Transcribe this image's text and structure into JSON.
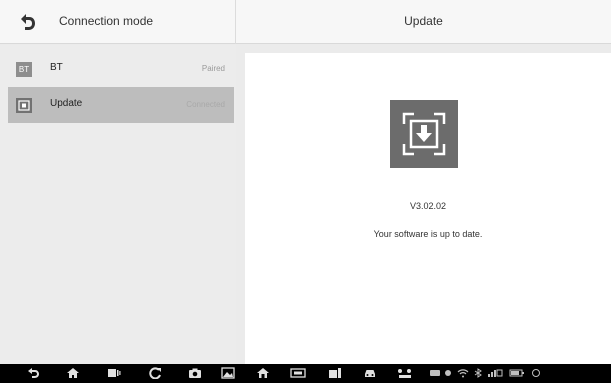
{
  "header": {
    "left_title": "Connection mode",
    "right_title": "Update"
  },
  "sidebar": {
    "items": [
      {
        "icon": "bt-icon",
        "icon_text": "BT",
        "label": "BT",
        "status": "Paired",
        "active": false
      },
      {
        "icon": "vci-box-icon",
        "label": "Update",
        "status": "Connected",
        "active": true
      }
    ]
  },
  "main": {
    "icon": "download-update-icon",
    "version": "V3.02.02",
    "message": "Your software is up to date."
  },
  "nav_bar": {
    "icons": [
      "back-icon",
      "home-icon",
      "recent-apps-icon",
      "refresh-icon",
      "camera-icon",
      "image-icon",
      "home-diagnostics-icon",
      "vci-icon",
      "service-icon",
      "car-icon",
      "network-icon",
      "message-icon",
      "location-icon",
      "wifi-icon"
    ]
  },
  "colors": {
    "topbar_bg": "#f7f7f7",
    "sidebar_bg": "#ececec",
    "active_item_bg": "#bdbdbd",
    "update_icon_bg": "#6c6c6c",
    "navbar_bg": "#000000"
  }
}
